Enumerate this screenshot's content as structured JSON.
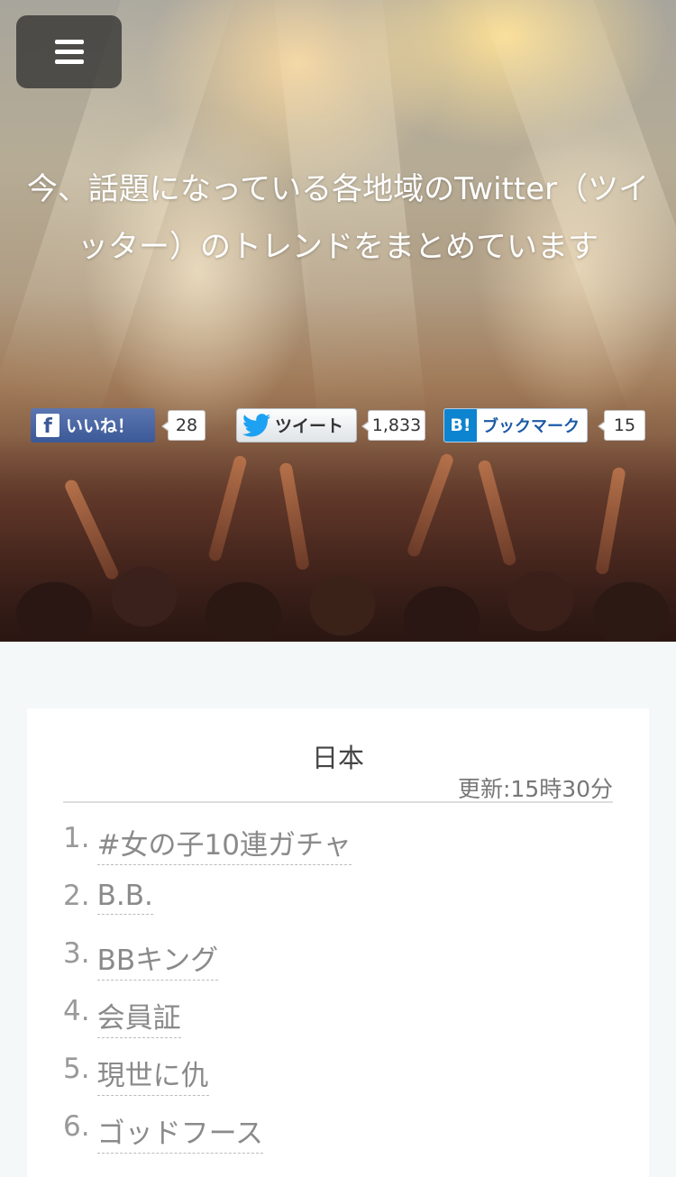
{
  "header": {
    "menu_icon": "hamburger-icon",
    "title": "今、話題になっている各地域のTwitter（ツイッター）のトレンドをまとめています"
  },
  "share": {
    "facebook": {
      "icon": "facebook-icon",
      "label": "いいね！",
      "count": "28"
    },
    "twitter": {
      "icon": "twitter-bird-icon",
      "label": "ツイート",
      "count": "1,833"
    },
    "hatena": {
      "icon": "hatena-bookmark-icon",
      "icon_text": "B!",
      "label": "ブックマーク",
      "count": "15"
    }
  },
  "section": {
    "title": "日本",
    "updated": "更新:15時30分"
  },
  "trends": [
    {
      "rank": "1.",
      "name": "#女の子10連ガチャ"
    },
    {
      "rank": "2.",
      "name": "B.B."
    },
    {
      "rank": "3.",
      "name": "BBキング"
    },
    {
      "rank": "4.",
      "name": "会員証"
    },
    {
      "rank": "5.",
      "name": "現世に仇"
    },
    {
      "rank": "6.",
      "name": "ゴッドフース"
    }
  ],
  "colors": {
    "facebook": "#3b5998",
    "twitter": "#1da1f2",
    "hatena": "#0d84cf",
    "page_bg": "#f4f8f8"
  }
}
